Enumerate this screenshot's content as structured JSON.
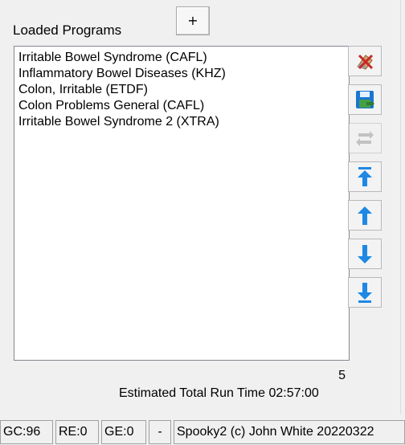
{
  "header": {
    "label": "Loaded Programs",
    "add_button_label": "+"
  },
  "programs": [
    "Irritable Bowel Syndrome (CAFL)",
    "Inflammatory Bowel Diseases (KHZ)",
    "Colon, Irritable (ETDF)",
    "Colon Problems General (CAFL)",
    "Irritable Bowel Syndrome 2 (XTRA)"
  ],
  "side_buttons": [
    {
      "icon": "eraser-clear-icon",
      "enabled": true
    },
    {
      "icon": "save-disk-icon",
      "enabled": true
    },
    {
      "icon": "swap-arrows-icon",
      "enabled": false
    },
    {
      "icon": "move-to-top-icon",
      "enabled": true
    },
    {
      "icon": "move-up-icon",
      "enabled": true
    },
    {
      "icon": "move-down-icon",
      "enabled": true
    },
    {
      "icon": "move-to-bottom-icon",
      "enabled": true
    }
  ],
  "summary": {
    "count": "5",
    "runtime": "Estimated Total Run Time 02:57:00"
  },
  "statusbar": {
    "gc": "GC:96",
    "re": "RE:0",
    "ge": "GE:0",
    "dash": "-",
    "copyright": "Spooky2 (c) John White 20220322"
  },
  "colors": {
    "arrow_blue": "#1e88e5",
    "disk_blue": "#1976d2",
    "disk_green": "#43a047",
    "eraser_red": "#c62828"
  }
}
